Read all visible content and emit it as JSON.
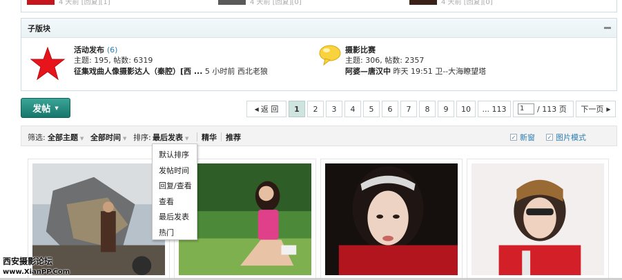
{
  "top_strip": {
    "items": [
      {
        "meta": "4 天前 [回复][1]",
        "thumb_color": "#c4161c"
      },
      {
        "meta": "4 天前 [回复][0]",
        "thumb_color": "#5a5a5a"
      },
      {
        "meta": "4 天前 [回复][0]",
        "thumb_color": "#3a2218"
      }
    ]
  },
  "subforum": {
    "heading": "子版块",
    "forums": [
      {
        "title": "活动发布",
        "count": "(6)",
        "stats": "主题: 195, 帖数: 6319",
        "last_post_title": "征集戏曲人像摄影达人（秦腔）[西 ...",
        "last_post_time": "5 小时前",
        "last_post_user": "西北老狼",
        "icon": "red-star-icon"
      },
      {
        "title": "摄影比赛",
        "count": "",
        "stats": "主题: 306, 帖数: 2357",
        "last_post_title": "阿婆—唐汉中",
        "last_post_time": "昨天 19:51",
        "last_post_user": "卫--大海瞭望塔",
        "icon": "speech-bubble-icon"
      }
    ]
  },
  "post_button": {
    "label": "发帖"
  },
  "pager": {
    "back_label": "返 回",
    "pages": [
      "1",
      "2",
      "3",
      "4",
      "5",
      "6",
      "7",
      "8",
      "9",
      "10"
    ],
    "current_page": "1",
    "last_page_label": "... 113",
    "page_input_value": "1",
    "total_label": "/ 113 页",
    "next_label": "下一页"
  },
  "filter_bar": {
    "filter_label": "筛选:",
    "all_topics": "全部主题",
    "all_time": "全部时间",
    "sort_label": "排序:",
    "sort_value": "最后发表",
    "digest": "精华",
    "recommend": "推荐",
    "new_window": "新窗",
    "image_mode": "图片模式"
  },
  "sort_menu": {
    "items": [
      "默认排序",
      "发帖时间",
      "回复/查看",
      "查看",
      "最后发表",
      "热门"
    ]
  },
  "watermark": {
    "line1": "西安摄影论坛",
    "line2": "www.XianPP.Com"
  },
  "colors": {
    "accent": "#2d7db3",
    "post_button": "#1f8a7e",
    "active_page": "#cfe4df"
  }
}
